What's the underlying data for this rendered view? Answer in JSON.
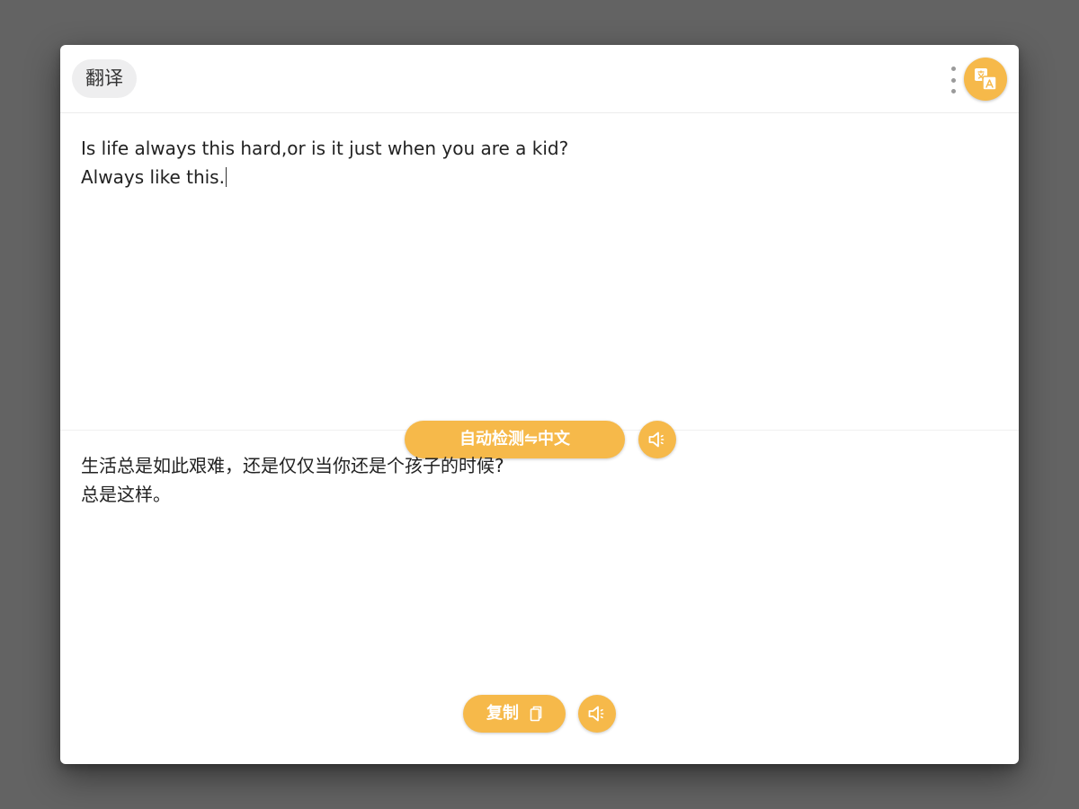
{
  "header": {
    "title": "翻译",
    "menu_icon": "kebab-menu-icon",
    "app_icon": "translate-icon"
  },
  "source": {
    "lines": [
      "Is life always this hard,or is it just when you are a kid?",
      "Always like this."
    ],
    "language_selector_label": "自动检测⇋中文",
    "speak_icon": "speaker-icon"
  },
  "target": {
    "lines": [
      "生活总是如此艰难，还是仅仅当你还是个孩子的时候?",
      "总是这样。"
    ],
    "copy_label": "复制",
    "copy_icon": "copy-icon",
    "speak_icon": "speaker-icon"
  },
  "colors": {
    "accent": "#f6b94a",
    "background": "#636363",
    "panel": "#ffffff",
    "chip": "#eeeeef"
  }
}
